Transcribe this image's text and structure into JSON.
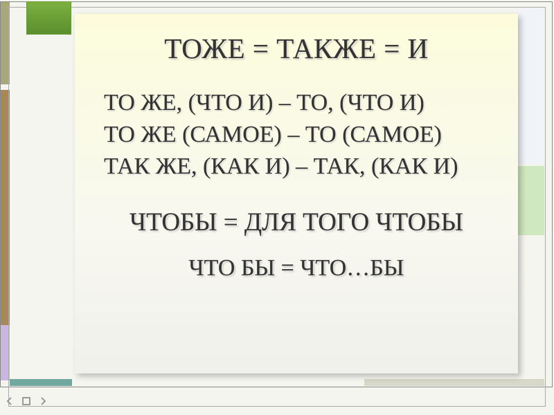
{
  "title": "ТОЖЕ = ТАКЖЕ = И",
  "lines": {
    "l1": "ТО  ЖЕ, (ЧТО И) – ТО, (ЧТО И)",
    "l2": "ТО  ЖЕ (САМОЕ) – ТО (САМОЕ)",
    "l3": "ТАК  ЖЕ, (КАК И) – ТАК, (КАК И)"
  },
  "sub1": "ЧТОБЫ = ДЛЯ ТОГО ЧТОБЫ",
  "sub2": "ЧТО  БЫ = ЧТО…БЫ"
}
